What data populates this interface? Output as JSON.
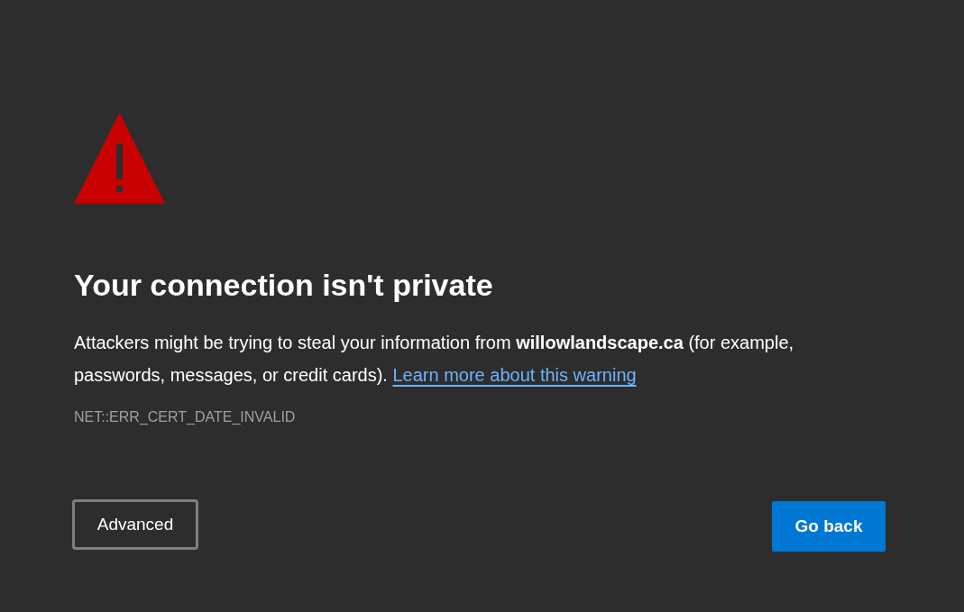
{
  "heading": "Your connection isn't private",
  "description": "Attackers might be trying to steal your information from **willowlandscape.ca** (for example, passwords, messages, or credit cards).",
  "learn_more_link": "Learn more about this warning",
  "error_code": "NET::ERR_CERT_DATE_INVALID",
  "buttons": [
    {
      "label": "Advanced",
      "kind": "secondary"
    },
    {
      "label": "Go back",
      "kind": "primary"
    }
  ]
}
